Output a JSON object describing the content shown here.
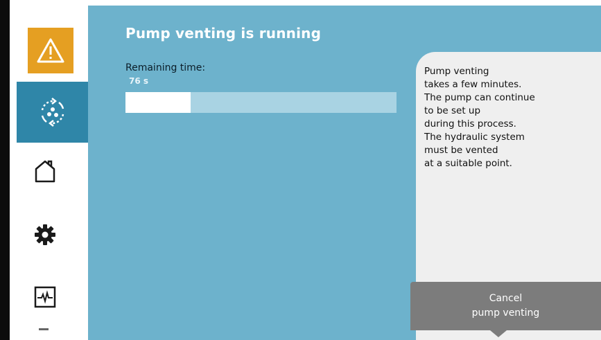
{
  "main": {
    "title": "Pump venting is running",
    "remaining_label": "Remaining time:",
    "remaining_value": "76 s",
    "progress_fraction": 0.24
  },
  "info": {
    "lines": [
      "Pump venting",
      "takes a few minutes.",
      "The pump can continue",
      "to be set up",
      "during this process.",
      "The hydraulic system",
      "must be vented",
      "at a suitable point."
    ]
  },
  "cancel_button": {
    "line1": "Cancel",
    "line2": "pump venting"
  },
  "sidebar": {
    "items": [
      {
        "icon": "warning-icon"
      },
      {
        "icon": "pump-venting-icon",
        "active": true
      },
      {
        "icon": "home-icon"
      },
      {
        "icon": "gear-icon"
      },
      {
        "icon": "diagnostics-icon"
      }
    ]
  },
  "colors": {
    "main_bg": "#6db2cc",
    "active_tile": "#2f86a8",
    "alert_tile": "#e59f22",
    "panel": "#efefef",
    "button": "#7c7c7c"
  }
}
